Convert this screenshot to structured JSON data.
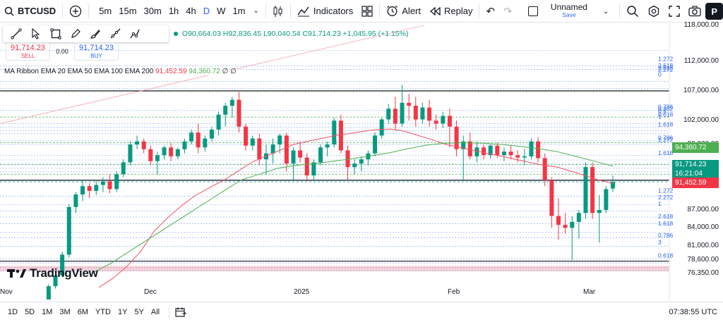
{
  "toolbar": {
    "symbol": "BTCUSD",
    "intervals": [
      "5m",
      "15m",
      "30m",
      "1h",
      "4h",
      "D",
      "W",
      "1m"
    ],
    "active_interval": "D",
    "indicators_label": "Indicators",
    "alert_label": "Alert",
    "replay_label": "Replay",
    "layout_name": "Unnamed",
    "save_label": "Save",
    "publish_label": "P"
  },
  "legend": {
    "open": "O90,664.03",
    "high": "H92,836.45",
    "low": "L90,040.54",
    "close": "C91,714.23",
    "change": "+1,045.95 (+1.15%)",
    "sell_price": "91,714.23",
    "sell_label": "SELL",
    "spread": "0.00",
    "buy_price": "91,714.23",
    "buy_label": "BUY",
    "ribbon_name": "MA Ribbon EMA 20 EMA 50 EMA 100 EMA 200",
    "ribbon_v1": "91,452.59",
    "ribbon_v2": "94,360.72",
    "ribbon_v3": "∅ ∅"
  },
  "logo_text": "TradingView",
  "price_axis": [
    "118,000.00",
    "112,000.00",
    "107,000.00",
    "102,000.00",
    "98,000.00",
    "87,000.00",
    "84,000.00",
    "81,000.00",
    "78,600.00",
    "76,350.00"
  ],
  "price_tags": {
    "ema50": "94,360.72",
    "last": "91,714.23",
    "countdown": "16:21:04",
    "ema20": "91,452.59"
  },
  "time_axis": [
    "Nov",
    "Dec",
    "2025",
    "Feb",
    "Mar"
  ],
  "fib_labels": [
    "1.272",
    "2.618",
    "3.618",
    "2.272",
    "0",
    "0.786",
    "0.382",
    "0.5",
    "0.618",
    "1",
    "1.618",
    "0.786",
    "1.272",
    "1.618",
    "1.272",
    "2.272",
    "1",
    "2.618",
    "1.618",
    "0.786",
    "3",
    "0.618"
  ],
  "ranges": [
    "1D",
    "5D",
    "1M",
    "3M",
    "6M",
    "YTD",
    "1Y",
    "5Y",
    "All"
  ],
  "clock": "07:38:55 UTC",
  "colors": {
    "up": "#089981",
    "down": "#f23645",
    "ema20": "#f7525f",
    "ema50": "#4caf50",
    "accent": "#2962ff"
  },
  "chart_data": {
    "type": "candlestick",
    "ylim": [
      76350,
      118000
    ],
    "candles": [
      [
        68000,
        69500,
        67000,
        69000
      ],
      [
        69000,
        71000,
        68500,
        70500
      ],
      [
        70500,
        72000,
        70000,
        71800
      ],
      [
        71800,
        74500,
        71500,
        74200
      ],
      [
        74200,
        76500,
        73800,
        76000
      ],
      [
        76000,
        80000,
        75800,
        79500
      ],
      [
        79500,
        88000,
        79000,
        87500
      ],
      [
        87500,
        90000,
        86500,
        89600
      ],
      [
        89600,
        92000,
        88500,
        91000
      ],
      [
        91000,
        91500,
        89000,
        90200
      ],
      [
        90200,
        91800,
        89500,
        91200
      ],
      [
        91200,
        92500,
        90000,
        91800
      ],
      [
        91800,
        93000,
        89800,
        90500
      ],
      [
        90500,
        93500,
        90000,
        93000
      ],
      [
        93000,
        95500,
        92500,
        95000
      ],
      [
        95000,
        98500,
        94500,
        98000
      ],
      [
        98000,
        99500,
        97200,
        98500
      ],
      [
        98500,
        99000,
        96500,
        97200
      ],
      [
        97200,
        97800,
        94500,
        95200
      ],
      [
        95200,
        96800,
        93000,
        96200
      ],
      [
        96200,
        97800,
        95500,
        97500
      ],
      [
        97500,
        98200,
        95200,
        96000
      ],
      [
        96000,
        97500,
        95500,
        97200
      ],
      [
        97200,
        99000,
        96500,
        98500
      ],
      [
        98500,
        100500,
        98000,
        100000
      ],
      [
        100000,
        101500,
        96500,
        97500
      ],
      [
        97500,
        99500,
        96800,
        99000
      ],
      [
        99000,
        101000,
        98500,
        100500
      ],
      [
        100500,
        103500,
        99500,
        103000
      ],
      [
        103000,
        105000,
        101000,
        104500
      ],
      [
        104500,
        106000,
        102500,
        105500
      ],
      [
        105500,
        106800,
        100000,
        101000
      ],
      [
        101000,
        101500,
        97000,
        97800
      ],
      [
        97800,
        99500,
        97000,
        99000
      ],
      [
        99000,
        99800,
        94500,
        95500
      ],
      [
        95500,
        98000,
        93000,
        96500
      ],
      [
        96500,
        99000,
        94800,
        98000
      ],
      [
        98000,
        99800,
        96500,
        99500
      ],
      [
        99500,
        100000,
        93500,
        94800
      ],
      [
        94800,
        97500,
        92000,
        97000
      ],
      [
        97000,
        98500,
        95000,
        95800
      ],
      [
        95800,
        96500,
        91800,
        92800
      ],
      [
        92800,
        95500,
        92000,
        95000
      ],
      [
        95000,
        98000,
        94500,
        97500
      ],
      [
        97500,
        98500,
        96000,
        98000
      ],
      [
        98000,
        102500,
        97500,
        102000
      ],
      [
        102000,
        103000,
        96500,
        97000
      ],
      [
        97000,
        97800,
        92000,
        94200
      ],
      [
        94200,
        95500,
        93000,
        94800
      ],
      [
        94800,
        96000,
        93500,
        95500
      ],
      [
        95500,
        97000,
        94500,
        96500
      ],
      [
        96500,
        100000,
        96000,
        99500
      ],
      [
        99500,
        102500,
        99000,
        102200
      ],
      [
        102200,
        104800,
        101500,
        104000
      ],
      [
        104000,
        106000,
        100500,
        101500
      ],
      [
        101500,
        108000,
        101000,
        105000
      ],
      [
        105000,
        106500,
        102000,
        104500
      ],
      [
        104500,
        106000,
        101000,
        102200
      ],
      [
        102200,
        105000,
        101500,
        104200
      ],
      [
        104200,
        105500,
        101000,
        102000
      ],
      [
        102000,
        103000,
        100500,
        101500
      ],
      [
        101500,
        103500,
        100800,
        102800
      ],
      [
        102800,
        104000,
        97500,
        101000
      ],
      [
        101000,
        102000,
        96000,
        97200
      ],
      [
        97200,
        99500,
        92000,
        98500
      ],
      [
        98500,
        100000,
        95500,
        96000
      ],
      [
        96000,
        98500,
        95000,
        97500
      ],
      [
        97500,
        98000,
        95500,
        96200
      ],
      [
        96200,
        98000,
        95600,
        97800
      ],
      [
        97800,
        98300,
        95800,
        96200
      ],
      [
        96200,
        97500,
        95200,
        96800
      ],
      [
        96800,
        97800,
        95500,
        96200
      ],
      [
        96200,
        97000,
        95000,
        95800
      ],
      [
        95800,
        97200,
        94500,
        96000
      ],
      [
        96000,
        99000,
        95500,
        98500
      ],
      [
        98500,
        99200,
        95000,
        95700
      ],
      [
        95700,
        96500,
        91000,
        92000
      ],
      [
        92000,
        92500,
        84000,
        86000
      ],
      [
        86000,
        89000,
        82000,
        84500
      ],
      [
        84500,
        86500,
        83000,
        84000
      ],
      [
        84000,
        86000,
        78600,
        85000
      ],
      [
        85000,
        87000,
        82200,
        86500
      ],
      [
        86500,
        95000,
        85500,
        94200
      ],
      [
        94200,
        95000,
        85500,
        86500
      ],
      [
        86500,
        89500,
        81500,
        87000
      ],
      [
        87000,
        91000,
        86500,
        90500
      ],
      [
        90600,
        92800,
        90000,
        91700
      ]
    ],
    "ema20": [
      74000,
      75500,
      77500,
      80000,
      83500,
      85800,
      87800,
      89500,
      90800,
      92000,
      93500,
      95000,
      96000,
      97000,
      98000,
      98500,
      99000,
      99500,
      99800,
      100200,
      100500,
      100600,
      100200,
      99500,
      98800,
      98000,
      97500,
      97000,
      96500,
      96000,
      95500,
      95000,
      94500,
      94200,
      93500,
      92800,
      92000,
      91450
    ],
    "ema50": [
      76350,
      78000,
      80000,
      82000,
      84000,
      86000,
      88000,
      90000,
      92000,
      93000,
      94000,
      94500,
      94800,
      95200,
      95600,
      96100,
      96600,
      97300,
      97900,
      98200,
      98300,
      98200,
      98000,
      97700,
      97300,
      96800,
      96000,
      95200,
      94360
    ]
  }
}
